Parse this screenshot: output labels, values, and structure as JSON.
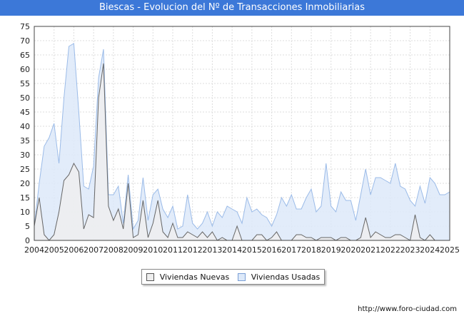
{
  "title": "Biescas - Evolucion del Nº de Transacciones Inmobiliarias",
  "source": "http://www.foro-ciudad.com",
  "colors": {
    "title_bg": "#3c78d8",
    "nuevas_line": "#666666",
    "nuevas_fill": "#eeeeee",
    "usadas_line": "#9bbbe8",
    "usadas_fill": "#dde9f9"
  },
  "chart_data": {
    "type": "area",
    "x_start": 2004,
    "periods_per_year": 4,
    "xticks": [
      "2004",
      "2005",
      "2006",
      "2007",
      "2008",
      "2009",
      "2010",
      "2011",
      "2012",
      "2013",
      "2014",
      "2015",
      "2016",
      "2017",
      "2018",
      "2019",
      "2020",
      "2021",
      "2022",
      "2023",
      "2024",
      "2025"
    ],
    "yticks": [
      0,
      5,
      10,
      15,
      20,
      25,
      30,
      35,
      40,
      45,
      50,
      55,
      60,
      65,
      70,
      75
    ],
    "ylim": [
      0,
      75
    ],
    "grid": true,
    "legend_position": "bottom",
    "series": [
      {
        "name": "Viviendas Nuevas",
        "values": [
          5,
          15,
          2,
          0,
          2,
          10,
          21,
          23,
          27,
          24,
          4,
          9,
          8,
          50,
          62,
          12,
          7,
          11,
          4,
          20,
          1,
          2,
          14,
          1,
          6,
          14,
          3,
          1,
          6,
          1,
          1,
          3,
          2,
          1,
          3,
          1,
          3,
          0,
          1,
          0,
          0,
          5,
          0,
          0,
          0,
          2,
          2,
          0,
          1,
          3,
          0,
          0,
          0,
          2,
          2,
          1,
          1,
          0,
          1,
          1,
          1,
          0,
          1,
          1,
          0,
          0,
          1,
          8,
          1,
          3,
          2,
          1,
          1,
          2,
          2,
          1,
          0,
          9,
          1,
          0,
          2,
          0
        ]
      },
      {
        "name": "Viviendas Usadas",
        "values": [
          5,
          20,
          33,
          36,
          41,
          27,
          50,
          68,
          69,
          45,
          19,
          18,
          26,
          57,
          67,
          16,
          16,
          19,
          6,
          23,
          4,
          7,
          22,
          7,
          16,
          18,
          11,
          8,
          12,
          4,
          5,
          16,
          6,
          4,
          6,
          10,
          5,
          10,
          8,
          12,
          11,
          10,
          6,
          15,
          10,
          11,
          9,
          8,
          5,
          9,
          15,
          12,
          16,
          11,
          11,
          15,
          18,
          10,
          12,
          27,
          12,
          10,
          17,
          14,
          14,
          7,
          16,
          25,
          16,
          22,
          22,
          21,
          20,
          27,
          19,
          18,
          14,
          12,
          19,
          13,
          22,
          20,
          16,
          16,
          17
        ]
      }
    ]
  }
}
